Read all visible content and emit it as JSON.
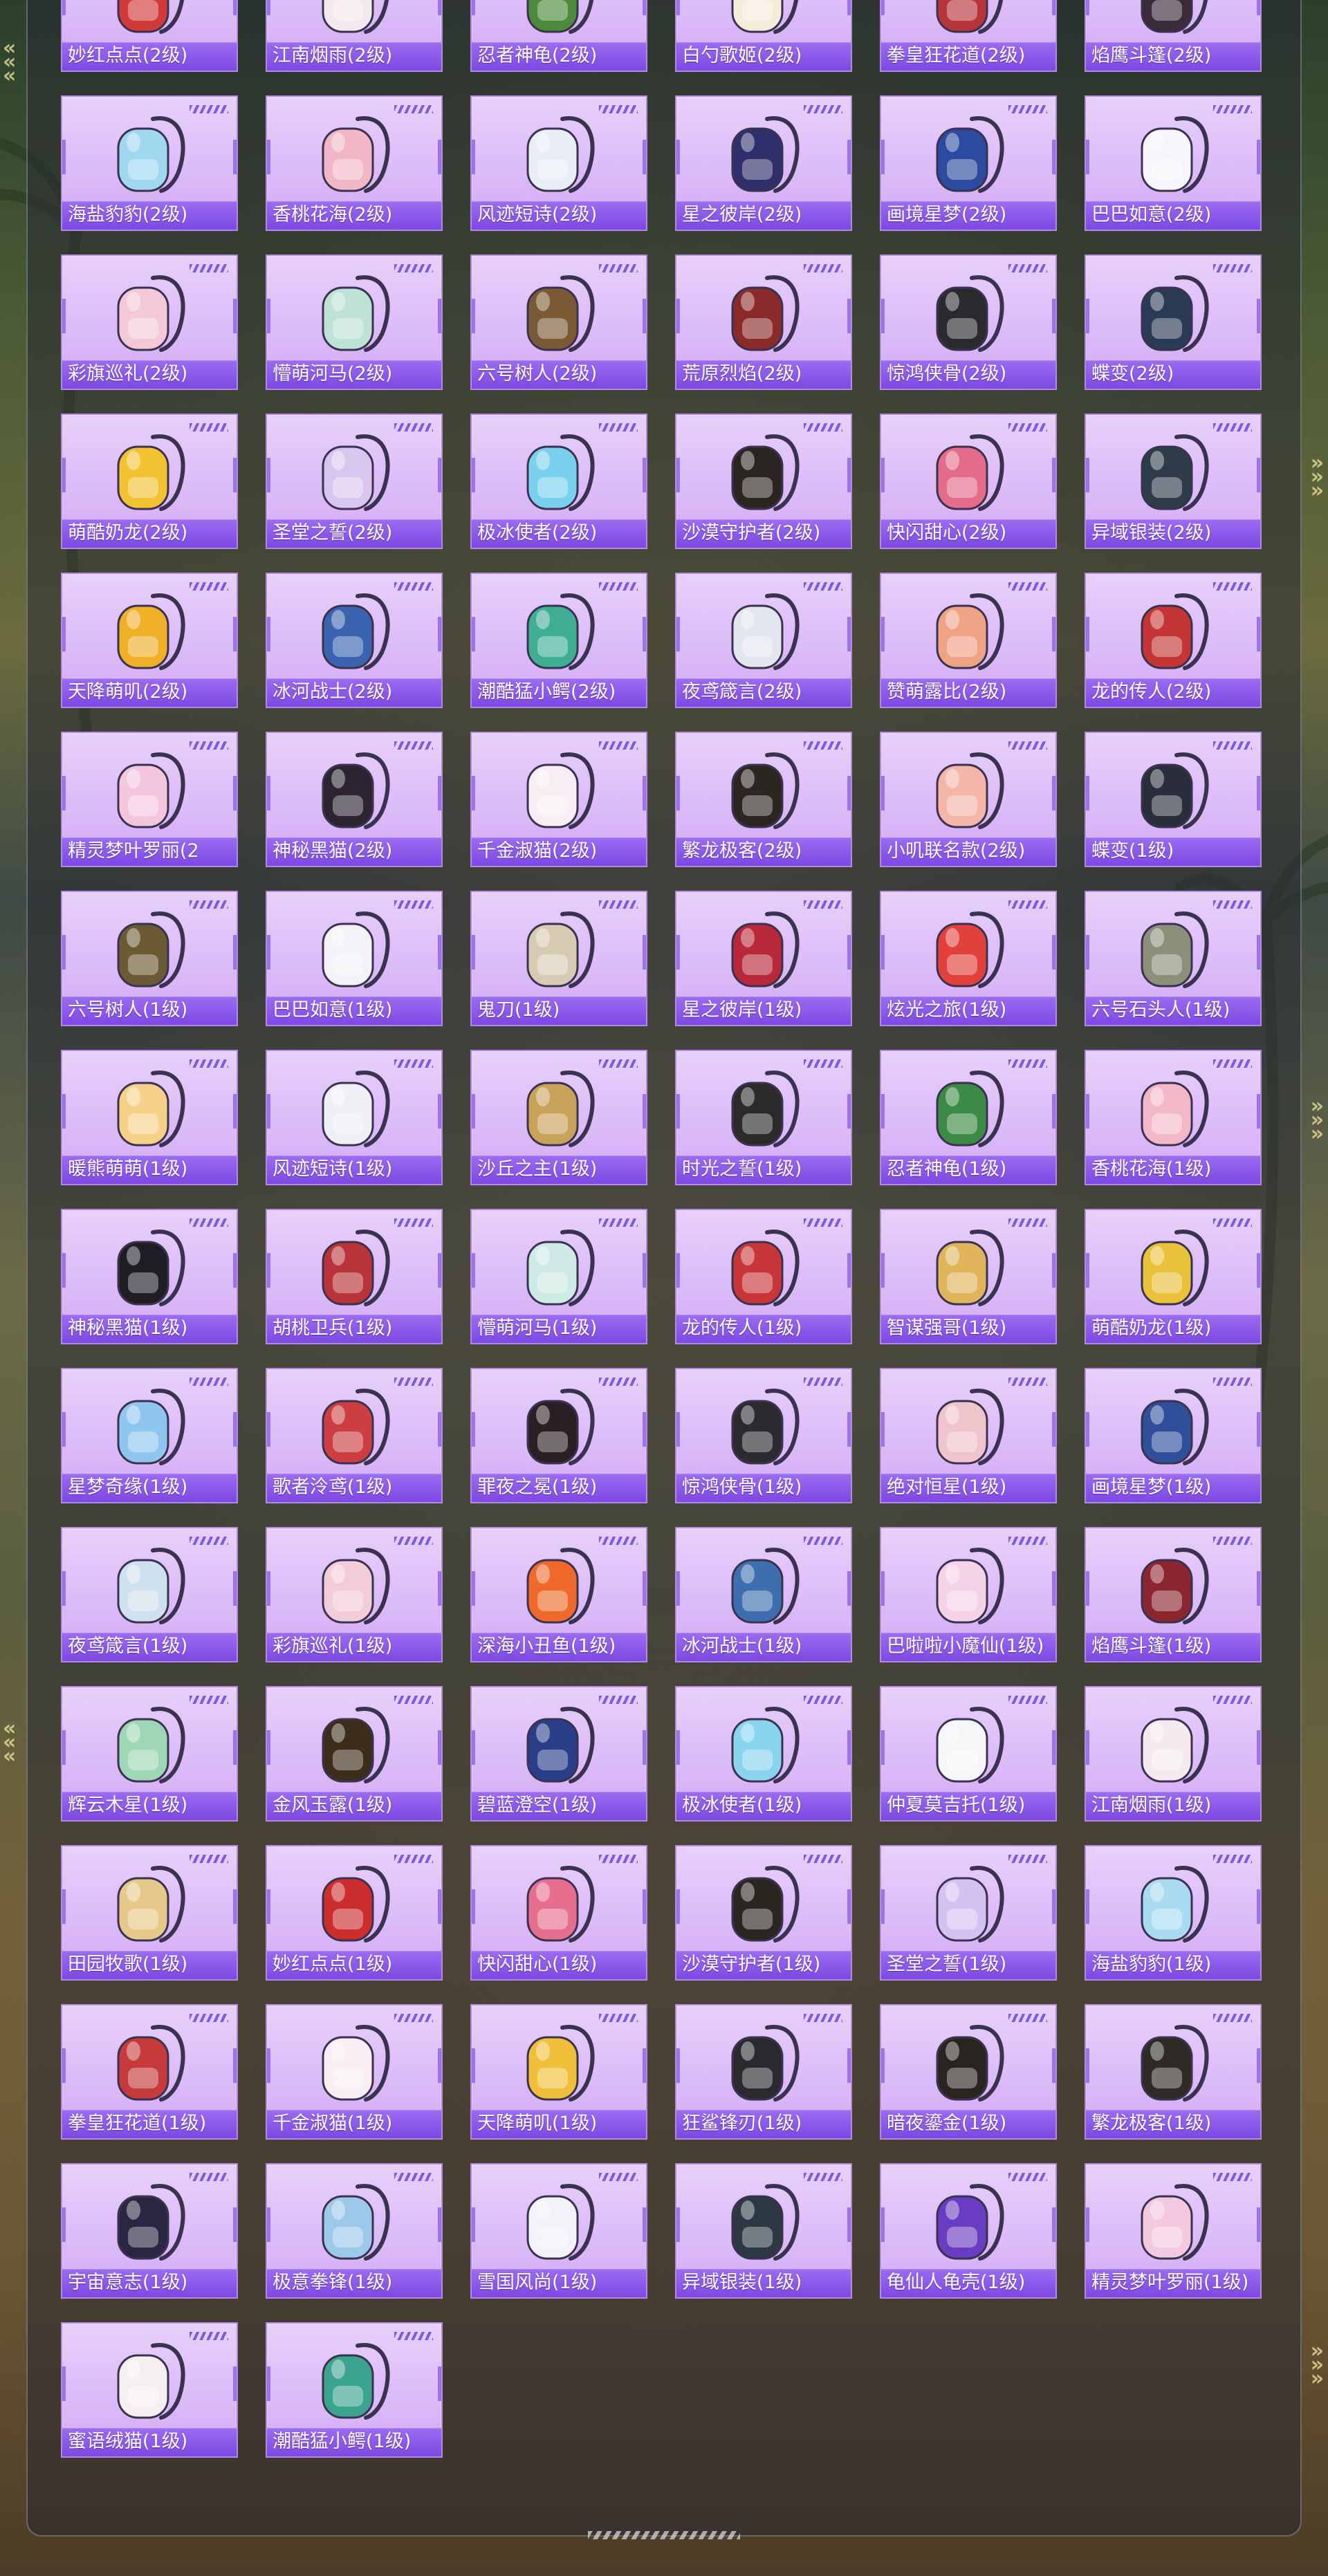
{
  "colors": {
    "tile_bg": "#dcb9f7",
    "label_bar": "#8a58ea",
    "label_text": "#ffffff",
    "stripe": "#7a5ce0"
  },
  "items": [
    {
      "name": "妙红点点(2级)",
      "icon": "red-apple-backpack",
      "color": "#d23a3a"
    },
    {
      "name": "江南烟雨(2级)",
      "icon": "white-flower-backpack",
      "color": "#f2e9ef"
    },
    {
      "name": "忍者神龟(2级)",
      "icon": "green-turtle-backpack",
      "color": "#4e8a3c"
    },
    {
      "name": "白勺歌姬(2级)",
      "icon": "cream-bunny-backpack",
      "color": "#f5ecdc"
    },
    {
      "name": "拳皇狂花道(2级)",
      "icon": "red-fighter-backpack",
      "color": "#b8343b"
    },
    {
      "name": "焰鹰斗篷(2级)",
      "icon": "dark-red-cape-backpack",
      "color": "#3a2a3a"
    },
    {
      "name": "海盐豹豹(2级)",
      "icon": "blue-seal-backpack",
      "color": "#9fd8ef"
    },
    {
      "name": "香桃花海(2级)",
      "icon": "pink-shell-backpack",
      "color": "#f1b7c7"
    },
    {
      "name": "风迹短诗(2级)",
      "icon": "white-pouch-backpack",
      "color": "#e9eef6"
    },
    {
      "name": "星之彼岸(2级)",
      "icon": "navy-space-backpack",
      "color": "#2f2f6b"
    },
    {
      "name": "画境星梦(2级)",
      "icon": "blue-book-backpack",
      "color": "#2b4aa0"
    },
    {
      "name": "巴巴如意(2级)",
      "icon": "white-rabbit-backpack",
      "color": "#f6f6fa"
    },
    {
      "name": "彩旗巡礼(2级)",
      "icon": "pink-ribbon-backpack",
      "color": "#f4c9d7"
    },
    {
      "name": "懵萌河马(2级)",
      "icon": "mint-hippo-backpack",
      "color": "#bfe2d7"
    },
    {
      "name": "六号树人(2级)",
      "icon": "wood-tree-backpack",
      "color": "#7a5a35"
    },
    {
      "name": "荒原烈焰(2级)",
      "icon": "red-flame-backpack",
      "color": "#8a2a2a"
    },
    {
      "name": "惊鸿侠骨(2级)",
      "icon": "black-armor-backpack",
      "color": "#2a2a2e"
    },
    {
      "name": "蝶变(2级)",
      "icon": "blue-butterfly-backpack",
      "color": "#2b3a55"
    },
    {
      "name": "萌酷奶龙(2级)",
      "icon": "yellow-dragon-backpack",
      "color": "#f2c232"
    },
    {
      "name": "圣堂之誓(2级)",
      "icon": "violet-heart-backpack",
      "color": "#d9c6ef"
    },
    {
      "name": "极冰使者(2级)",
      "icon": "ice-crystal-backpack",
      "color": "#7ad0ef"
    },
    {
      "name": "沙漠守护者(2级)",
      "icon": "black-anubis-backpack",
      "color": "#2a2520"
    },
    {
      "name": "快闪甜心(2级)",
      "icon": "pink-camera-backpack",
      "color": "#e56b8a"
    },
    {
      "name": "异域银装(2级)",
      "icon": "silver-case-backpack",
      "color": "#2e3c4a"
    },
    {
      "name": "天降萌叽(2级)",
      "icon": "orange-gold-backpack",
      "color": "#efb028"
    },
    {
      "name": "冰河战士(2级)",
      "icon": "blue-camo-backpack",
      "color": "#3a63b0"
    },
    {
      "name": "潮酷猛小鳄(2级)",
      "icon": "teal-croc-backpack",
      "color": "#3fae94"
    },
    {
      "name": "夜鸢箴言(2级)",
      "icon": "white-charm-backpack",
      "color": "#e3e6ef"
    },
    {
      "name": "赞萌露比(2级)",
      "icon": "peach-beaver-backpack",
      "color": "#f0a284"
    },
    {
      "name": "龙的传人(2级)",
      "icon": "red-chinese-backpack",
      "color": "#c43535"
    },
    {
      "name": "精灵梦叶罗丽(2",
      "icon": "pink-heart-backpack",
      "color": "#f4c6de"
    },
    {
      "name": "神秘黑猫(2级)",
      "icon": "black-cat-backpack",
      "color": "#2a2530"
    },
    {
      "name": "千金淑猫(2级)",
      "icon": "white-bunny-bow-backpack",
      "color": "#f7eef4"
    },
    {
      "name": "繁龙极客(2级)",
      "icon": "black-gold-dragon-backpack",
      "color": "#2b2620"
    },
    {
      "name": "小叽联名款(2级)",
      "icon": "pink-chick-backpack",
      "color": "#f3b6a8"
    },
    {
      "name": "蝶变(1级)",
      "icon": "black-butterfly-backpack",
      "color": "#2a2e3a"
    },
    {
      "name": "六号树人(1级)",
      "icon": "birdhouse-backpack",
      "color": "#6b5a33"
    },
    {
      "name": "巴巴如意(1级)",
      "icon": "white-ghost-backpack",
      "color": "#f3f3f7"
    },
    {
      "name": "鬼刀(1级)",
      "icon": "sword-charm-backpack",
      "color": "#d8cbb3"
    },
    {
      "name": "星之彼岸(1级)",
      "icon": "red-planet-backpack",
      "color": "#b8283a"
    },
    {
      "name": "炫光之旅(1级)",
      "icon": "claw-machine-backpack",
      "color": "#e2403a"
    },
    {
      "name": "六号石头人(1级)",
      "icon": "stone-golem-backpack",
      "color": "#8c8f7a"
    },
    {
      "name": "暖熊萌萌(1级)",
      "icon": "bear-bag-backpack",
      "color": "#f6d289"
    },
    {
      "name": "风迹短诗(1级)",
      "icon": "white-mini-backpack",
      "color": "#eef0f6"
    },
    {
      "name": "沙丘之主(1级)",
      "icon": "compass-charm-backpack",
      "color": "#c9a25a"
    },
    {
      "name": "时光之誓(1级)",
      "icon": "clock-gear-backpack",
      "color": "#2b2a28"
    },
    {
      "name": "忍者神龟(1级)",
      "icon": "turtle-ninja-backpack",
      "color": "#3b8a45"
    },
    {
      "name": "香桃花海(1级)",
      "icon": "pink-shell-mini-backpack",
      "color": "#f3b8c8"
    },
    {
      "name": "神秘黑猫(1级)",
      "icon": "round-black-cat-backpack",
      "color": "#1f1c24"
    },
    {
      "name": "胡桃卫兵(1级)",
      "icon": "nutcracker-backpack",
      "color": "#b8343a"
    },
    {
      "name": "懵萌河马(1级)",
      "icon": "mint-bunny-backpack",
      "color": "#cfe9e4"
    },
    {
      "name": "龙的传人(1级)",
      "icon": "red-school-backpack",
      "color": "#c8363a"
    },
    {
      "name": "智谋强哥(1级)",
      "icon": "bear-face-backpack",
      "color": "#e0b45a"
    },
    {
      "name": "萌酷奶龙(1级)",
      "icon": "yellow-cup-backpack",
      "color": "#e9c13b"
    },
    {
      "name": "星梦奇缘(1级)",
      "icon": "blue-swan-backpack",
      "color": "#8fc6ef"
    },
    {
      "name": "歌者泠鸢(1级)",
      "icon": "red-lantern-backpack",
      "color": "#cc3e42"
    },
    {
      "name": "罪夜之冕(1级)",
      "icon": "black-crown-backpack",
      "color": "#2a1f25"
    },
    {
      "name": "惊鸿侠骨(1级)",
      "icon": "black-red-armor-backpack",
      "color": "#2c2a2e"
    },
    {
      "name": "绝对恒星(1级)",
      "icon": "pink-drink-backpack",
      "color": "#f0c4cb"
    },
    {
      "name": "画境星梦(1级)",
      "icon": "blue-tome-backpack",
      "color": "#2f4f9b"
    },
    {
      "name": "夜鸢箴言(1级)",
      "icon": "blue-charm-backpack",
      "color": "#cfe0ef"
    },
    {
      "name": "彩旗巡礼(1级)",
      "icon": "pink-flag-backpack",
      "color": "#f3ccd9"
    },
    {
      "name": "深海小丑鱼(1级)",
      "icon": "clownfish-backpack",
      "color": "#ef6a2a"
    },
    {
      "name": "冰河战士(1级)",
      "icon": "ice-armor-backpack",
      "color": "#3d6fae"
    },
    {
      "name": "巴啦啦小魔仙(1级)",
      "icon": "pink-magic-backpack",
      "color": "#f5d3e6"
    },
    {
      "name": "焰鹰斗篷(1级)",
      "icon": "red-black-cape-backpack",
      "color": "#8b2630"
    },
    {
      "name": "辉云木星(1级)",
      "icon": "green-orb-backpack",
      "color": "#9ed7b5"
    },
    {
      "name": "金风玉露(1级)",
      "icon": "black-gold-backpack",
      "color": "#3b2d1a"
    },
    {
      "name": "碧蓝澄空(1级)",
      "icon": "navy-sling-backpack",
      "color": "#2a3f8a"
    },
    {
      "name": "极冰使者(1级)",
      "icon": "ice-shard-backpack",
      "color": "#89d4ee"
    },
    {
      "name": "仲夏莫吉托(1级)",
      "icon": "white-cup-backpack",
      "color": "#f4f6f7"
    },
    {
      "name": "江南烟雨(1级)",
      "icon": "white-petal-backpack",
      "color": "#f5eaf0"
    },
    {
      "name": "田园牧歌(1级)",
      "icon": "basket-backpack",
      "color": "#e6c98a"
    },
    {
      "name": "妙红点点(1级)",
      "icon": "red-ball-backpack",
      "color": "#cc2e2e"
    },
    {
      "name": "快闪甜心(1级)",
      "icon": "pink-cam-mini-backpack",
      "color": "#e66f90"
    },
    {
      "name": "沙漠守护者(1级)",
      "icon": "dark-pharaoh-backpack",
      "color": "#2a2620"
    },
    {
      "name": "圣堂之誓(1级)",
      "icon": "purple-heart-backpack",
      "color": "#d6c2f2"
    },
    {
      "name": "海盐豹豹(1级)",
      "icon": "blue-seal-mini-backpack",
      "color": "#a9dcf0"
    },
    {
      "name": "拳皇狂花道(1级)",
      "icon": "red-bow-backpack",
      "color": "#c53a3a"
    },
    {
      "name": "千金淑猫(1级)",
      "icon": "white-bow-backpack",
      "color": "#f8eef3"
    },
    {
      "name": "天降萌叽(1级)",
      "icon": "yellow-bottle-backpack",
      "color": "#f0bf3a"
    },
    {
      "name": "狂鲨锋刃(1级)",
      "icon": "black-shark-backpack",
      "color": "#2a2a2e"
    },
    {
      "name": "暗夜鎏金(1级)",
      "icon": "black-gold-armor-backpack",
      "color": "#2a2420"
    },
    {
      "name": "繁龙极客(1级)",
      "icon": "black-dragon-backpack",
      "color": "#2e2a25"
    },
    {
      "name": "宇宙意志(1级)",
      "icon": "cosmic-crown-backpack",
      "color": "#2a2540"
    },
    {
      "name": "极意拳锋(1级)",
      "icon": "blue-cup-backpack",
      "color": "#9cc8ea"
    },
    {
      "name": "雪国风尚(1级)",
      "icon": "white-snow-bunny-backpack",
      "color": "#f2f2f8"
    },
    {
      "name": "异域银装(1级)",
      "icon": "dark-silver-backpack",
      "color": "#2c3844"
    },
    {
      "name": "龟仙人龟壳(1级)",
      "icon": "purple-shell-backpack",
      "color": "#6a3cc2"
    },
    {
      "name": "精灵梦叶罗丽(1级)",
      "icon": "pink-fairy-backpack",
      "color": "#f3c9df"
    },
    {
      "name": "蜜语绒猫(1级)",
      "icon": "white-cat-backpack",
      "color": "#f5f0ef"
    },
    {
      "name": "潮酷猛小鳄(1级)",
      "icon": "teal-croc-mini-backpack",
      "color": "#3aa48f"
    }
  ]
}
